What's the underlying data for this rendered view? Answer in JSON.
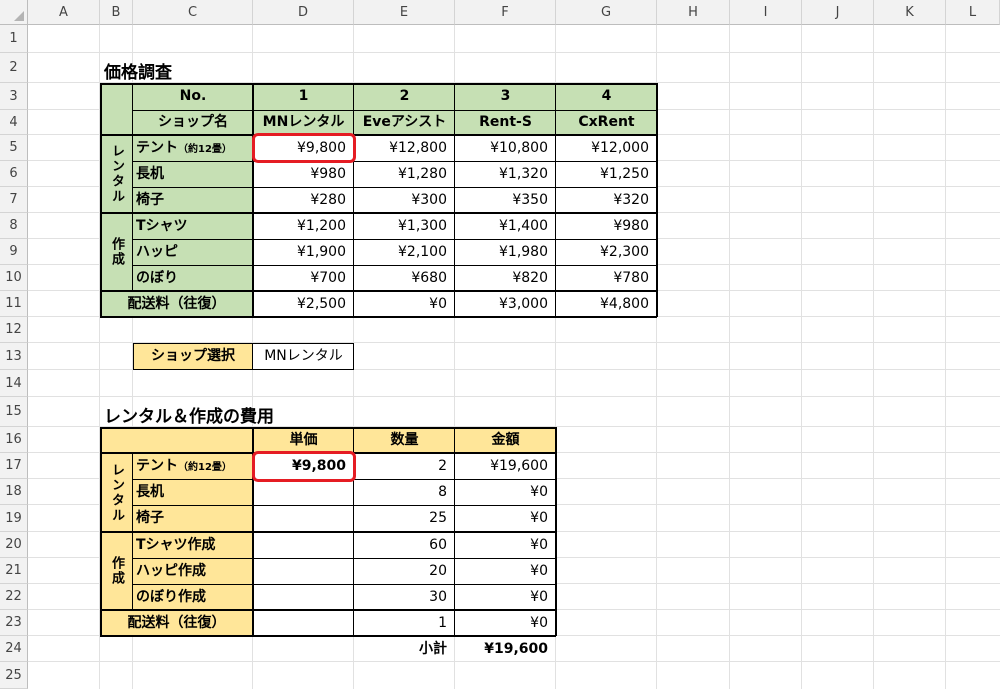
{
  "columns": [
    "A",
    "B",
    "C",
    "D",
    "E",
    "F",
    "G",
    "H",
    "I",
    "J",
    "K",
    "L"
  ],
  "rows": [
    "1",
    "2",
    "3",
    "4",
    "5",
    "6",
    "7",
    "8",
    "9",
    "10",
    "11",
    "12",
    "13",
    "14",
    "15",
    "16",
    "17",
    "18",
    "19",
    "20",
    "21",
    "22",
    "23",
    "24",
    "25"
  ],
  "price_table": {
    "title": "価格調査",
    "no_label": "No.",
    "shop_name_label": "ショップ名",
    "shop_numbers": [
      "1",
      "2",
      "3",
      "4"
    ],
    "shops": [
      "MNレンタル",
      "Eveアシスト",
      "Rent-S",
      "CxRent"
    ],
    "group_rental": "レンタル",
    "group_make": "作成",
    "items": [
      {
        "name": "テント",
        "note": "（約12畳）",
        "values": [
          "¥9,800",
          "¥12,800",
          "¥10,800",
          "¥12,000"
        ]
      },
      {
        "name": "長机",
        "note": "",
        "values": [
          "¥980",
          "¥1,280",
          "¥1,320",
          "¥1,250"
        ]
      },
      {
        "name": "椅子",
        "note": "",
        "values": [
          "¥280",
          "¥300",
          "¥350",
          "¥320"
        ]
      },
      {
        "name": "Tシャツ",
        "note": "",
        "values": [
          "¥1,200",
          "¥1,300",
          "¥1,400",
          "¥980"
        ]
      },
      {
        "name": "ハッピ",
        "note": "",
        "values": [
          "¥1,900",
          "¥2,100",
          "¥1,980",
          "¥2,300"
        ]
      },
      {
        "name": "のぼり",
        "note": "",
        "values": [
          "¥700",
          "¥680",
          "¥820",
          "¥780"
        ]
      }
    ],
    "shipping_label": "配送料（往復）",
    "shipping_values": [
      "¥2,500",
      "¥0",
      "¥3,000",
      "¥4,800"
    ]
  },
  "shop_select": {
    "label": "ショップ選択",
    "value": "MNレンタル"
  },
  "cost_table": {
    "title": "レンタル＆作成の費用",
    "headers": [
      "単価",
      "数量",
      "金額"
    ],
    "group_rental": "レンタル",
    "group_make": "作成",
    "items": [
      {
        "name": "テント",
        "note": "（約12畳）",
        "unit": "¥9,800",
        "qty": "2",
        "amount": "¥19,600"
      },
      {
        "name": "長机",
        "note": "",
        "unit": "",
        "qty": "8",
        "amount": "¥0"
      },
      {
        "name": "椅子",
        "note": "",
        "unit": "",
        "qty": "25",
        "amount": "¥0"
      },
      {
        "name": "Tシャツ作成",
        "note": "",
        "unit": "",
        "qty": "60",
        "amount": "¥0"
      },
      {
        "name": "ハッピ作成",
        "note": "",
        "unit": "",
        "qty": "20",
        "amount": "¥0"
      },
      {
        "name": "のぼり作成",
        "note": "",
        "unit": "",
        "qty": "30",
        "amount": "¥0"
      }
    ],
    "shipping_label": "配送料（往復）",
    "shipping_unit": "",
    "shipping_qty": "1",
    "shipping_amount": "¥0",
    "subtotal_label": "小計",
    "subtotal_value": "¥19,600"
  },
  "colors": {
    "green_fill": "#c6e0b4",
    "orange_fill": "#ffe699",
    "highlight": "#e51c23"
  }
}
